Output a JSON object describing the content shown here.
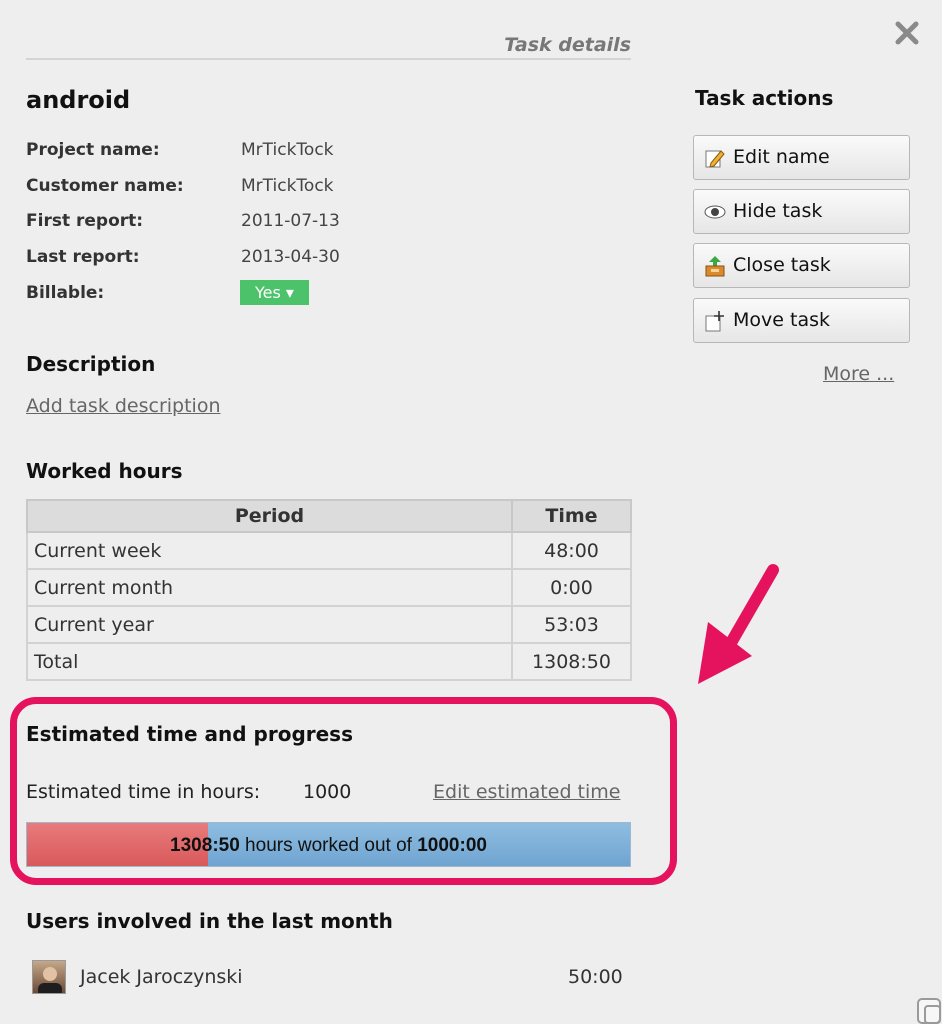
{
  "dialog": {
    "title": "Task details",
    "close_icon": "close-icon"
  },
  "task": {
    "name": "android",
    "fields": [
      {
        "label": "Project name:",
        "value": "MrTickTock"
      },
      {
        "label": "Customer name:",
        "value": "MrTickTock"
      },
      {
        "label": "First report:",
        "value": "2011-07-13"
      },
      {
        "label": "Last report:",
        "value": "2013-04-30"
      },
      {
        "label": "Billable:",
        "value": "Yes ▾"
      }
    ]
  },
  "description": {
    "heading": "Description",
    "add_link": "Add task description"
  },
  "worked_hours": {
    "heading": "Worked hours",
    "columns": [
      "Period",
      "Time"
    ],
    "rows": [
      {
        "period": "Current week",
        "time": "48:00"
      },
      {
        "period": "Current month",
        "time": "0:00"
      },
      {
        "period": "Current year",
        "time": "53:03"
      },
      {
        "period": "Total",
        "time": "1308:50"
      }
    ]
  },
  "estimate": {
    "heading": "Estimated time and progress",
    "label": "Estimated time in hours:",
    "value": "1000",
    "edit_link": "Edit estimated time",
    "progress": {
      "worked": "1308:50",
      "middle_text": " hours worked out of ",
      "estimated": "1000:00",
      "fill_fraction": 0.3
    }
  },
  "users": {
    "heading": "Users involved in the last month",
    "list": [
      {
        "name": "Jacek Jaroczynski",
        "time": "50:00"
      }
    ]
  },
  "actions": {
    "heading": "Task actions",
    "buttons": [
      {
        "label": "Edit name",
        "icon": "edit-pencil-icon"
      },
      {
        "label": "Hide task",
        "icon": "eye-icon"
      },
      {
        "label": "Close task",
        "icon": "archive-box-icon"
      },
      {
        "label": "Move task",
        "icon": "move-task-icon"
      }
    ],
    "more_link": "More ..."
  },
  "colors": {
    "accent_highlight": "#e5125d",
    "billable_green": "#4cc36a",
    "progress_red": "#d9595b",
    "progress_blue": "#7aaed8"
  }
}
